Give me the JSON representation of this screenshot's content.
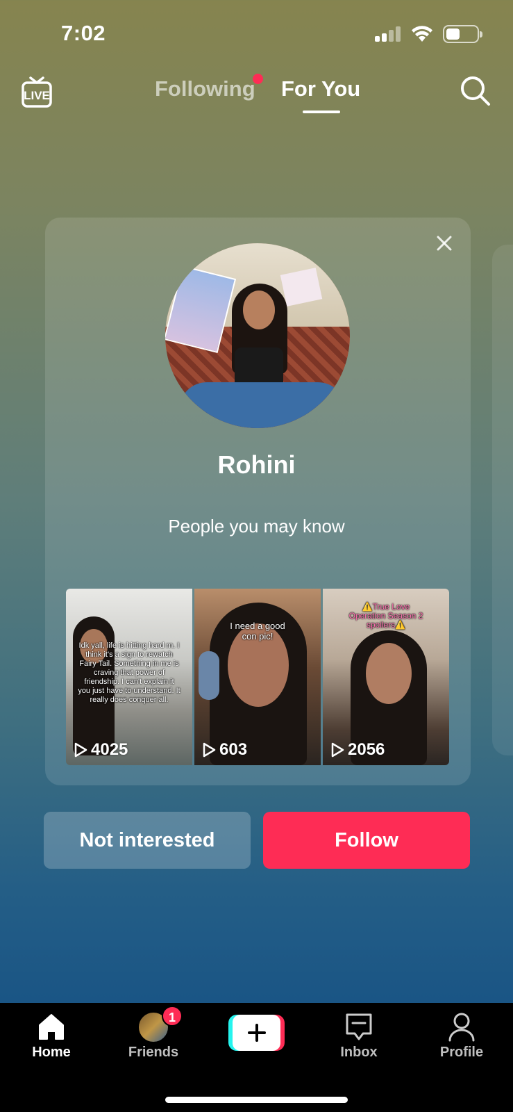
{
  "status_bar": {
    "time": "7:02",
    "battery_level": 0.45
  },
  "top_nav": {
    "live_label": "LIVE",
    "tabs": [
      {
        "label": "Following",
        "active": false,
        "has_dot": true
      },
      {
        "label": "For You",
        "active": true
      }
    ]
  },
  "suggestion_card": {
    "name": "Rohini",
    "subtitle": "People you may know",
    "videos": [
      {
        "caption": "Idk yall, life is hitting hard rn. I think it's a sign to rewatch Fairy Tail. Something in me is craving that power of friendship. I can't explain it you just have to understand. It really does conquer all.",
        "plays": "4025"
      },
      {
        "caption": "I need a good con pic!",
        "plays": "603"
      },
      {
        "caption": "⚠️True Love Operation Season 2 spoilers⚠️",
        "plays": "2056"
      }
    ],
    "buttons": {
      "not_interested": "Not interested",
      "follow": "Follow"
    }
  },
  "bottom_nav": {
    "items": [
      {
        "label": "Home",
        "icon": "home-icon",
        "active": true
      },
      {
        "label": "Friends",
        "icon": "friends-avatar",
        "badge": "1"
      },
      {
        "label": "",
        "icon": "plus-icon"
      },
      {
        "label": "Inbox",
        "icon": "inbox-icon"
      },
      {
        "label": "Profile",
        "icon": "profile-icon"
      }
    ]
  },
  "colors": {
    "accent": "#fe2c55",
    "cyan": "#25f4ee"
  }
}
